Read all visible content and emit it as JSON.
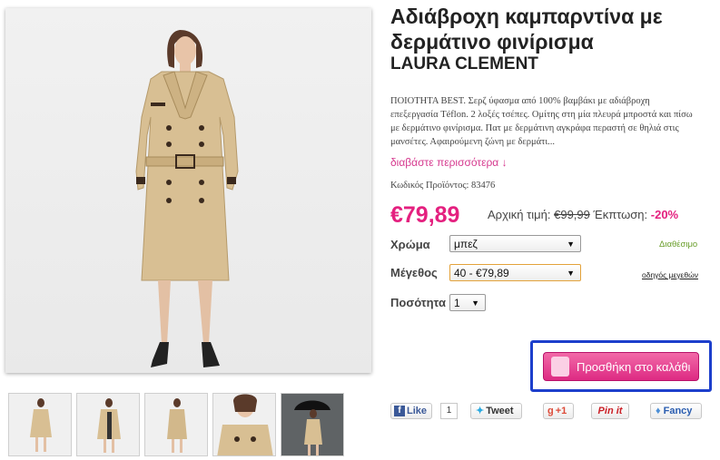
{
  "product": {
    "title": "Αδιάβροχη καμπαρντίνα με δερμάτινο φινίρισμα",
    "brand": "LAURA CLEMENT",
    "description": "ΠΟΙΟΤΗΤΑ BEST. Σερζ ύφασμα από 100% βαμβάκι με αδιάβροχη επεξεργασία Téflon. 2 λοξές τσέπες. Ομίτης στη μία πλευρά μπροστά και πίσω με δερμάτινο φινίρισμα. Πατ με δερμάτινη αγκράφα περαστή σε θηλιά στις μανσέτες. Αφαιρούμενη ζώνη με δερμάτι...",
    "read_more": "διαβάστε περισσότερα ↓",
    "code_text": "Κωδικός Προϊόντος: 83476",
    "price": "€79,89",
    "orig_label": "Αρχική τιμή:",
    "orig_price": "€99,99",
    "disc_label": "Έκπτωση:",
    "discount": "-20%"
  },
  "options": {
    "color_label": "Χρώμα",
    "color_value": "μπεζ",
    "availability": "Διαθέσιμο",
    "size_label": "Μέγεθος",
    "size_value": "40 - €79,89",
    "size_guide": "οδηγός μεγεθών",
    "qty_label": "Ποσότητα",
    "qty_value": "1"
  },
  "cart": {
    "label": "Προσθήκη στο καλάθι"
  },
  "social": {
    "like": "Like",
    "like_count": "1",
    "tweet": "Tweet",
    "gplus": "+1",
    "pinit": "Pin it",
    "fancy": "Fancy"
  },
  "colors": {
    "accent": "#e4207f",
    "highlight": "#1d3fcc",
    "available": "#6a9e2b"
  },
  "thumbnails": [
    "front",
    "open",
    "back",
    "detail",
    "umbrella"
  ]
}
